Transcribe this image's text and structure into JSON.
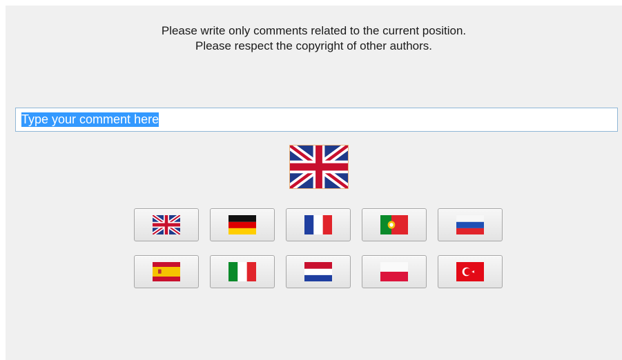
{
  "notice": {
    "line1": "Please write only comments related to the current position.",
    "line2": "Please respect the copyright of other authors."
  },
  "comment_input": {
    "value": "Type your comment here"
  },
  "selected_language": "english",
  "language_buttons": [
    {
      "id": "english",
      "icon": "uk-flag-icon"
    },
    {
      "id": "german",
      "icon": "germany-flag-icon"
    },
    {
      "id": "french",
      "icon": "france-flag-icon"
    },
    {
      "id": "portuguese",
      "icon": "portugal-flag-icon"
    },
    {
      "id": "russian",
      "icon": "russia-flag-icon"
    },
    {
      "id": "spanish",
      "icon": "spain-flag-icon"
    },
    {
      "id": "italian",
      "icon": "italy-flag-icon"
    },
    {
      "id": "dutch",
      "icon": "netherlands-flag-icon"
    },
    {
      "id": "polish",
      "icon": "poland-flag-icon"
    },
    {
      "id": "turkish",
      "icon": "turkey-flag-icon"
    }
  ]
}
